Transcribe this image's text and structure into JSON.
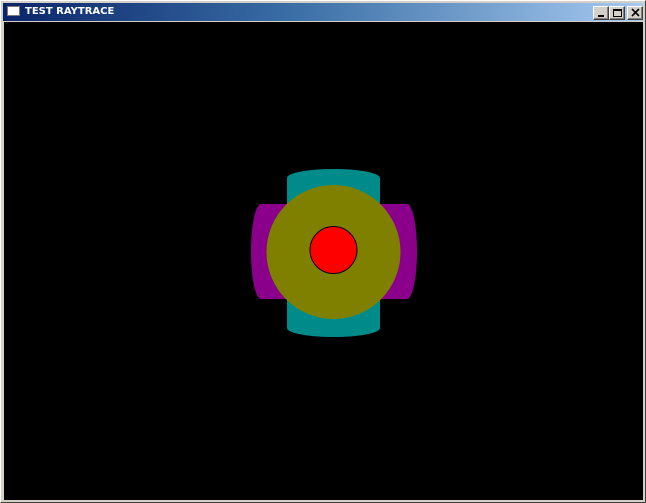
{
  "window": {
    "title": "TEST RAYTRACE",
    "icons": {
      "app": "window-icon",
      "minimize": "minimize-icon",
      "maximize": "maximize-icon",
      "close": "close-icon"
    }
  },
  "scene": {
    "background_color": "#000000",
    "objects": [
      {
        "name": "teal-cylinder",
        "color": "#008b8b"
      },
      {
        "name": "purple-cylinder",
        "color": "#8b008b"
      },
      {
        "name": "olive-sphere",
        "color": "#808000"
      },
      {
        "name": "red-sphere",
        "color": "#ff0000"
      }
    ]
  }
}
